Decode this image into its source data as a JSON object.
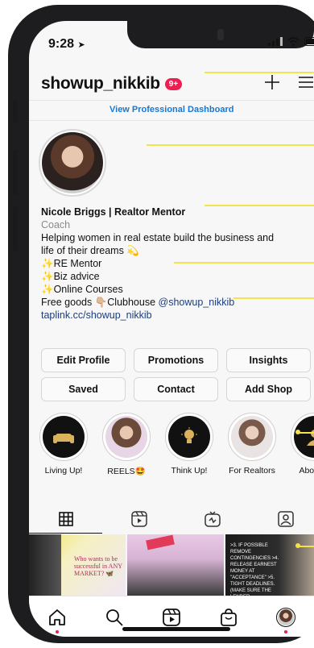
{
  "status": {
    "time": "9:28"
  },
  "header": {
    "username": "showup_nikkib",
    "badge": "9+"
  },
  "dashboard_link": "View Professional Dashboard",
  "bio": {
    "name": "Nicole Briggs | Realtor Mentor",
    "category": "Coach",
    "lines": [
      "Helping women in real estate build the business and",
      "life of their dreams 💫",
      "✨RE Mentor",
      "✨Biz advice",
      "✨Online Courses"
    ],
    "free_goods_prefix": "Free goods 👇🏼Clubhouse ",
    "mention": "@showup_nikkib",
    "link": "taplink.cc/showup_nikkib"
  },
  "buttons": [
    "Edit Profile",
    "Promotions",
    "Insights",
    "Saved",
    "Contact",
    "Add Shop"
  ],
  "highlights": [
    {
      "label": "Living Up!"
    },
    {
      "label": "REELS🤩"
    },
    {
      "label": "Think Up!"
    },
    {
      "label": "For Realtors"
    },
    {
      "label": "About M"
    }
  ],
  "posts": [
    {
      "text": "Who wants to be successful in ANY MARKET? 🦋"
    },
    {
      "text": ""
    },
    {
      "text": ">3. IF POSSIBLE REMOVE CONTINGENCIES >4. RELEASE EARNEST MONEY AT \"ACCEPTANCE\" >5. TIGHT DEADLINES. (MAKE SURE THE LENDER"
    }
  ],
  "colors": {
    "accent": "#1877d2",
    "badge": "#ee1d52",
    "annotation": "#f4e24a"
  }
}
